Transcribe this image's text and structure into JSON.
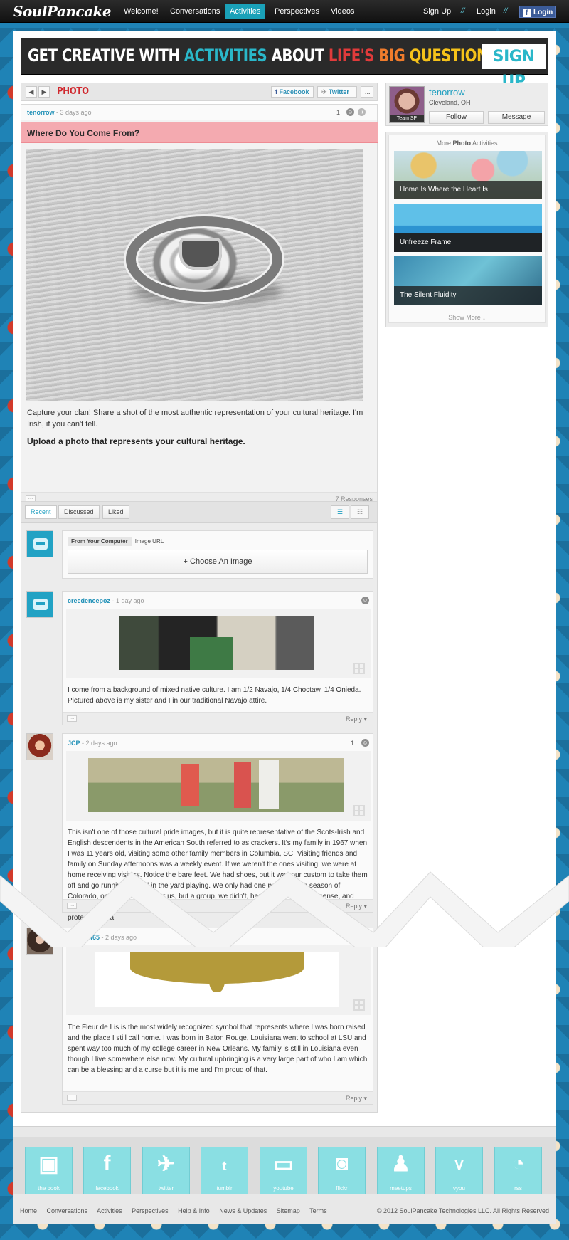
{
  "nav": {
    "logo": "SoulPancake",
    "links": [
      "Welcome!",
      "Conversations",
      "Activities",
      "Perspectives",
      "Videos"
    ],
    "active": "Activities",
    "signup": "Sign Up",
    "sep": "//",
    "login": "Login",
    "fb_login": "Login"
  },
  "banner": {
    "part1": "GET CREATIVE WITH ",
    "part2": "ACTIVITIES",
    "part3": " ABOUT ",
    "part4": "LIFE'S ",
    "part5": "BIG ",
    "part6": "QUESTIONS",
    "cta": "SIGN UP"
  },
  "activity": {
    "type_label": "PHOTO",
    "share_facebook": "Facebook",
    "share_twitter": "Twitter",
    "more": "...",
    "author": "tenorrow",
    "time": " - 3 days ago",
    "likes": "1",
    "title": "Where Do You Come From?",
    "description": "Capture your clan! Share a shot of the most authentic representation of your cultural heritage. I'm Irish, if you can't tell.",
    "prompt": "Upload a photo that represents your cultural heritage.",
    "responses": "7 Responses"
  },
  "profile": {
    "name": "tenorrow",
    "location": "Cleveland, OH",
    "team": "Team SP",
    "follow": "Follow",
    "message": "Message"
  },
  "more_activities": {
    "title_pre": "More ",
    "title_bold": "Photo",
    "title_post": " Activities",
    "items": [
      "Home Is Where the Heart Is",
      "Unfreeze Frame",
      "The Silent Fluidity"
    ],
    "show_more": "Show More ↓"
  },
  "responses": {
    "tabs": [
      "Recent",
      "Discussed",
      "Liked"
    ],
    "upload": {
      "tab_computer": "From Your Computer",
      "tab_url": "Image URL",
      "choose": "+ Choose An Image"
    },
    "items": [
      {
        "author": "creedencepoz",
        "time": " - 1 day ago",
        "likes": "",
        "text": "I come from a background of mixed native culture. I am 1/2 Navajo, 1/4 Choctaw, 1/4 Onieda. Pictured above is my sister and I in our traditional Navajo attire.",
        "reply": "Reply ▾"
      },
      {
        "author": "JCP",
        "time": " - 2 days ago",
        "likes": "1",
        "text": "This isn't one of those cultural pride images, but it is quite representative of the Scots-Irish and English descendents in the American South referred to as crackers. It's my family in 1967 when I was 11 years old, visiting some other family members in Columbia, SC. Visiting friends and family on Sunday afternoons was a weekly event. If we weren't the ones visiting, we were at home receiving visitors. Notice the bare feet. We had shoes, but it was our custom to take them off and go running around in the yard playing. We only had one pair for each season of Colorado, only two seasons for us, but a group, we didn't, had a ton of common sense, and learned to figure anything out. Our mainstay, but love and faith kept us connected and protective as a",
        "reply": "Reply ▾"
      },
      {
        "author": "Novelist65",
        "time": " - 2 days ago",
        "likes": "2",
        "text": "The Fleur de Lis is the most widely recognized symbol that represents where I was born raised and the place I still call home. I was born in Baton Rouge, Louisiana went to school at LSU and spent way too much of my college career in New Orleans. My family is still in Louisiana even though I live somewhere else now. My cultural upbringing is a very large part of who I am which can be a blessing and a curse but it is me and I'm proud of that.",
        "reply": "Reply ▾"
      }
    ]
  },
  "footer": {
    "icons": [
      "the book",
      "facebook",
      "twitter",
      "tumblr",
      "youtube",
      "flickr",
      "meetups",
      "vyou",
      "rss"
    ],
    "links": [
      "Home",
      "Conversations",
      "Activities",
      "Perspectives",
      "Help & Info",
      "News & Updates",
      "Sitemap",
      "Terms"
    ],
    "copyright": "© 2012 SoulPancake Technologies LLC. All Rights Reserved"
  },
  "colors": {
    "accent": "#1aa1b8",
    "link": "#1f90b7",
    "photo_label": "#d0282e",
    "question_bg": "#f4aab0",
    "footer_icon": "#8adfe3"
  }
}
